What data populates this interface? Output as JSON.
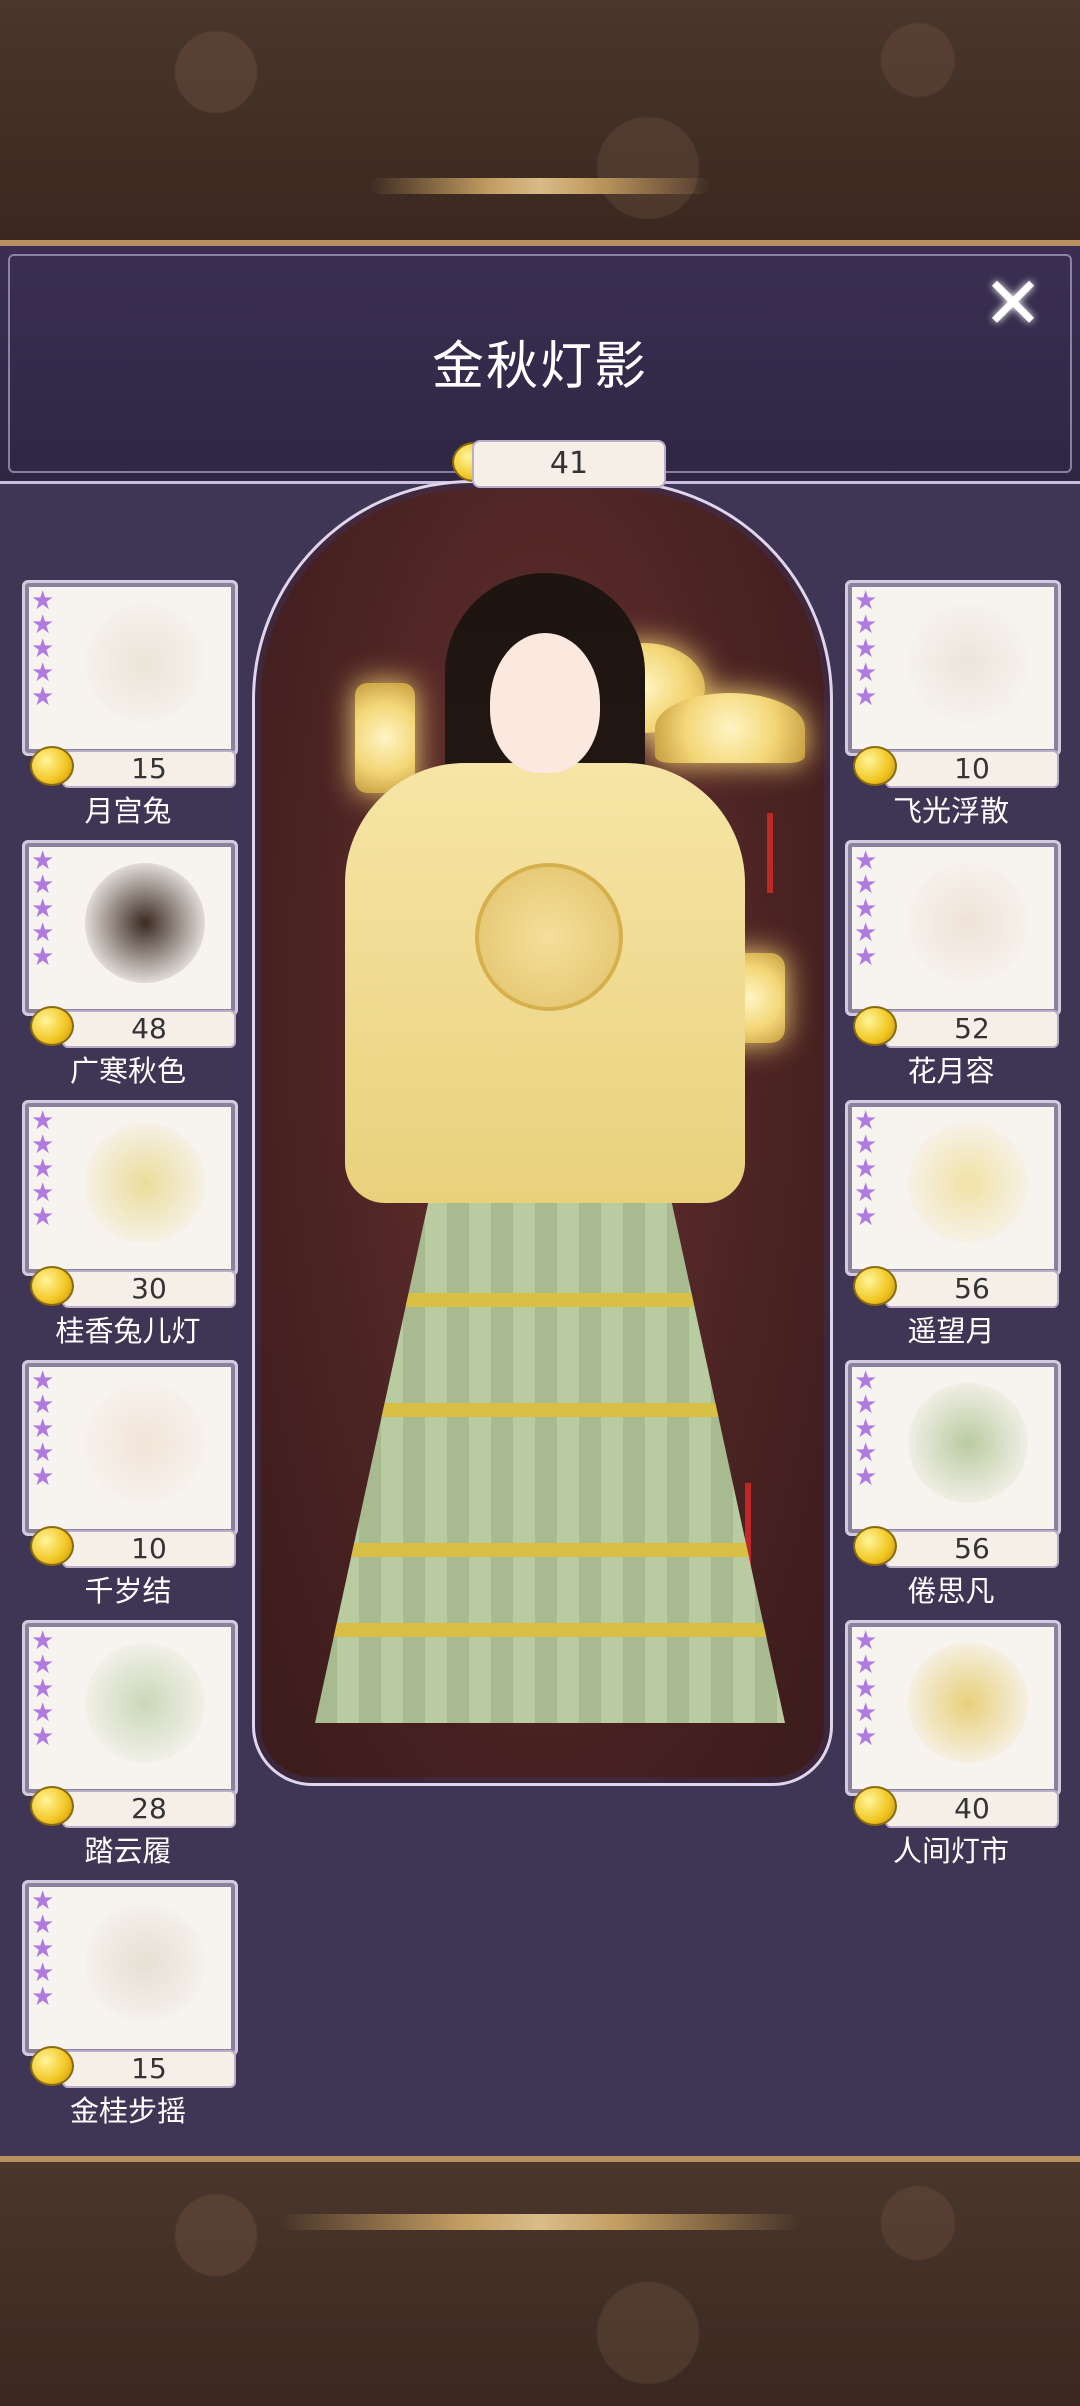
{
  "title": "金秋灯影",
  "close_label": "✕",
  "total_count": "41",
  "left_items": [
    {
      "name": "月宫兔",
      "count": "15",
      "stars": 5,
      "thumb": "hair-white-icon"
    },
    {
      "name": "广寒秋色",
      "count": "48",
      "stars": 5,
      "thumb": "hair-dark-icon"
    },
    {
      "name": "桂香兔儿灯",
      "count": "30",
      "stars": 5,
      "thumb": "rabbit-lantern-icon"
    },
    {
      "name": "千岁结",
      "count": "10",
      "stars": 5,
      "thumb": "bracelet-icon"
    },
    {
      "name": "踏云履",
      "count": "28",
      "stars": 5,
      "thumb": "shoes-icon"
    },
    {
      "name": "金桂步摇",
      "count": "15",
      "stars": 5,
      "thumb": "hairpin-icon"
    }
  ],
  "right_items": [
    {
      "name": "飞光浮散",
      "count": "10",
      "stars": 5,
      "thumb": "hair-short-icon"
    },
    {
      "name": "花月容",
      "count": "52",
      "stars": 5,
      "thumb": "face-makeup-icon"
    },
    {
      "name": "遥望月",
      "count": "56",
      "stars": 5,
      "thumb": "top-garment-icon"
    },
    {
      "name": "倦思凡",
      "count": "56",
      "stars": 5,
      "thumb": "skirt-icon"
    },
    {
      "name": "人间灯市",
      "count": "40",
      "stars": 5,
      "thumb": "lantern-stall-icon"
    }
  ],
  "colors": {
    "star": "#b07be0",
    "panel": "#3f3554",
    "coin": "#f1c520"
  }
}
